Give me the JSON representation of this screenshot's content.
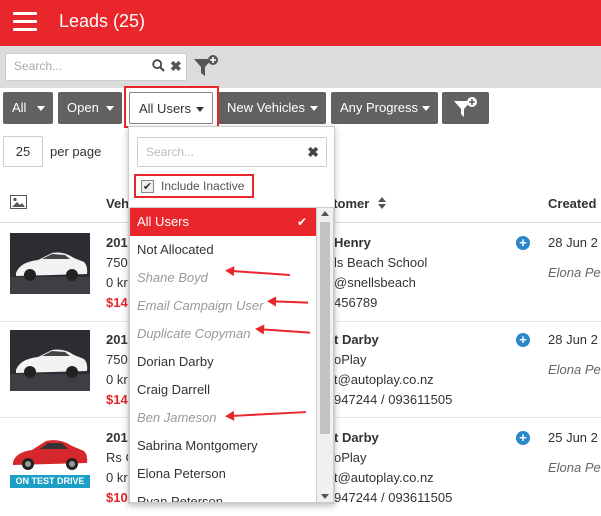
{
  "header": {
    "title": "Leads (25)",
    "brand_color": "#e8262b"
  },
  "search": {
    "placeholder": "Search..."
  },
  "filters": {
    "status": "All",
    "state": "Open",
    "user": "All Users",
    "vehicles": "New Vehicles",
    "progress": "Any Progress"
  },
  "pagination": {
    "per_page": "25",
    "per_page_label": "per page"
  },
  "table": {
    "headers": {
      "vehicle": "Vehi",
      "customer": "stomer",
      "created": "Created"
    },
    "rows": [
      {
        "year": "201",
        "model": "750",
        "km": "0 kr",
        "price": "$14",
        "customer_name": "Henry",
        "customer_line2": "ls Beach School",
        "customer_line3": "@snellsbeach",
        "customer_line4": "456789",
        "created": "28 Jun 2",
        "created_by": "Elona Pet"
      },
      {
        "year": "201",
        "model": "750",
        "km": "0 kr",
        "price": "$14",
        "customer_name": "t Darby",
        "customer_line2": "oPlay",
        "customer_line3": "t@autoplay.co.nz",
        "customer_line4": "947244 / 093611505",
        "created": "28 Jun 2",
        "created_by": "Elona Pet"
      },
      {
        "year": "201",
        "model": "Rs C",
        "km": "0 kr",
        "price": "$10",
        "customer_name": "t Darby",
        "customer_line2": "oPlay",
        "customer_line3": "t@autoplay.co.nz",
        "customer_line4": "947244 / 093611505",
        "created": "25 Jun 2",
        "created_by": "Elona Pet",
        "badge": "ON TEST DRIVE"
      }
    ]
  },
  "dropdown": {
    "search_placeholder": "Search...",
    "include_inactive_label": "Include Inactive",
    "include_inactive_checked": true,
    "items": [
      {
        "label": "All Users",
        "selected": true,
        "inactive": false
      },
      {
        "label": "Not Allocated",
        "selected": false,
        "inactive": false
      },
      {
        "label": "Shane Boyd",
        "selected": false,
        "inactive": true
      },
      {
        "label": "Email Campaign User",
        "selected": false,
        "inactive": true
      },
      {
        "label": "Duplicate Copyman",
        "selected": false,
        "inactive": true
      },
      {
        "label": "Dorian Darby",
        "selected": false,
        "inactive": false
      },
      {
        "label": "Craig Darrell",
        "selected": false,
        "inactive": false
      },
      {
        "label": "Ben Jameson",
        "selected": false,
        "inactive": true
      },
      {
        "label": "Sabrina Montgomery",
        "selected": false,
        "inactive": false
      },
      {
        "label": "Elona Peterson",
        "selected": false,
        "inactive": false
      },
      {
        "label": "Ryan Peterson",
        "selected": false,
        "inactive": false
      }
    ]
  }
}
